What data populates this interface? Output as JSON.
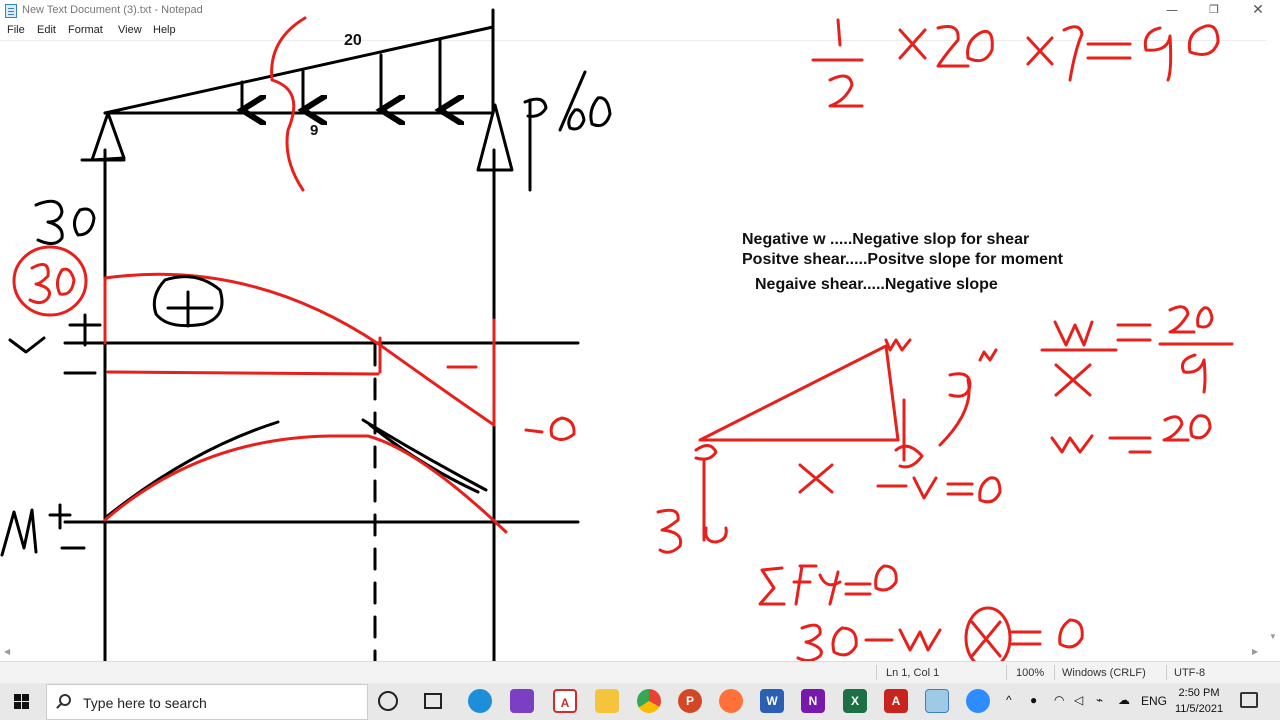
{
  "window": {
    "title": "New Text Document (3).txt - Notepad",
    "min_glyph": "—",
    "max_glyph": "❐",
    "close_glyph": "✕"
  },
  "menu": [
    "File",
    "Edit",
    "Format",
    "View",
    "Help"
  ],
  "editor": {
    "lines": [
      "Negative w .....Negative slop for shear",
      "Positve shear.....Positve slope for moment",
      "Negaive shear.....Negative slope"
    ]
  },
  "drawing": {
    "load_top_label": "20",
    "span_label": "9",
    "handwritten": {
      "reaction_left": "30",
      "reaction_right": "60",
      "shear_start": "30",
      "shear_end": "-60",
      "area_calc": "1/2 x20 x9 = 90",
      "ratio": "w / x = 20 / 9",
      "w_expr": "w = 20",
      "span_m": "9 m",
      "sum_fy": "ΣFy = 0",
      "equilibrium": "30 - w x = 0",
      "v_eq": "v = 0",
      "tri_w": "w",
      "tri_x": "x",
      "tri_base": "30",
      "v_axis": "v",
      "m_axis": "M"
    },
    "colors": {
      "ink_black": "#000000",
      "ink_red": "#e8201c"
    }
  },
  "status": {
    "position": "Ln 1, Col 1",
    "zoom": "100%",
    "line_endings": "Windows (CRLF)",
    "encoding": "UTF-8"
  },
  "taskbar": {
    "search_placeholder": "Type here to search",
    "apps": [
      {
        "icon": "cortana-icon"
      },
      {
        "icon": "task-view-icon"
      },
      {
        "icon": "edge-icon"
      },
      {
        "icon": "visual-studio-icon"
      },
      {
        "icon": "acrobat-icon"
      },
      {
        "icon": "file-explorer-icon"
      },
      {
        "icon": "chrome-icon"
      },
      {
        "icon": "powerpoint-icon"
      },
      {
        "icon": "firefox-icon"
      },
      {
        "icon": "word-icon"
      },
      {
        "icon": "onenote-icon"
      },
      {
        "icon": "excel-icon"
      },
      {
        "icon": "pdf-icon"
      },
      {
        "icon": "notepad-icon"
      },
      {
        "icon": "zoom-icon"
      }
    ],
    "language": "ENG",
    "time": "2:50 PM",
    "date": "11/5/2021"
  }
}
